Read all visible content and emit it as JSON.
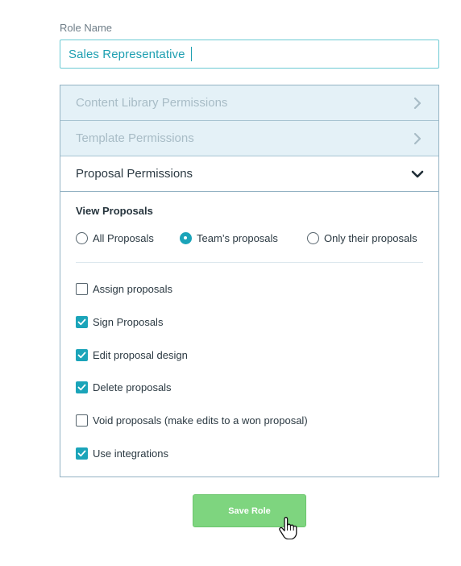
{
  "form": {
    "role_name_label": "Role Name",
    "role_name_value": "Sales Representative"
  },
  "accordion": [
    {
      "label": "Content Library Permissions",
      "state": "collapsed",
      "icon": "chevron-right-icon"
    },
    {
      "label": "Template Permissions",
      "state": "collapsed",
      "icon": "chevron-right-icon"
    },
    {
      "label": "Proposal Permissions",
      "state": "expanded",
      "icon": "chevron-down-icon"
    }
  ],
  "proposal_permissions": {
    "view_title": "View Proposals",
    "view_options": [
      {
        "label": "All Proposals",
        "selected": false
      },
      {
        "label": "Team’s proposals",
        "selected": true
      },
      {
        "label": "Only their proposals",
        "selected": false
      }
    ],
    "checkboxes": [
      {
        "label": "Assign proposals",
        "checked": false
      },
      {
        "label": "Sign Proposals",
        "checked": true
      },
      {
        "label": "Edit proposal design",
        "checked": true
      },
      {
        "label": "Delete proposals",
        "checked": true
      },
      {
        "label": "Void proposals (make edits to a won proposal)",
        "checked": false
      },
      {
        "label": "Use integrations",
        "checked": true
      }
    ]
  },
  "actions": {
    "save_label": "Save Role"
  },
  "colors": {
    "accent": "#1ba4b9",
    "input_text": "#1e9fb1",
    "collapsed_bg": "#e4f1f7",
    "save_button": "#7ed57f"
  }
}
